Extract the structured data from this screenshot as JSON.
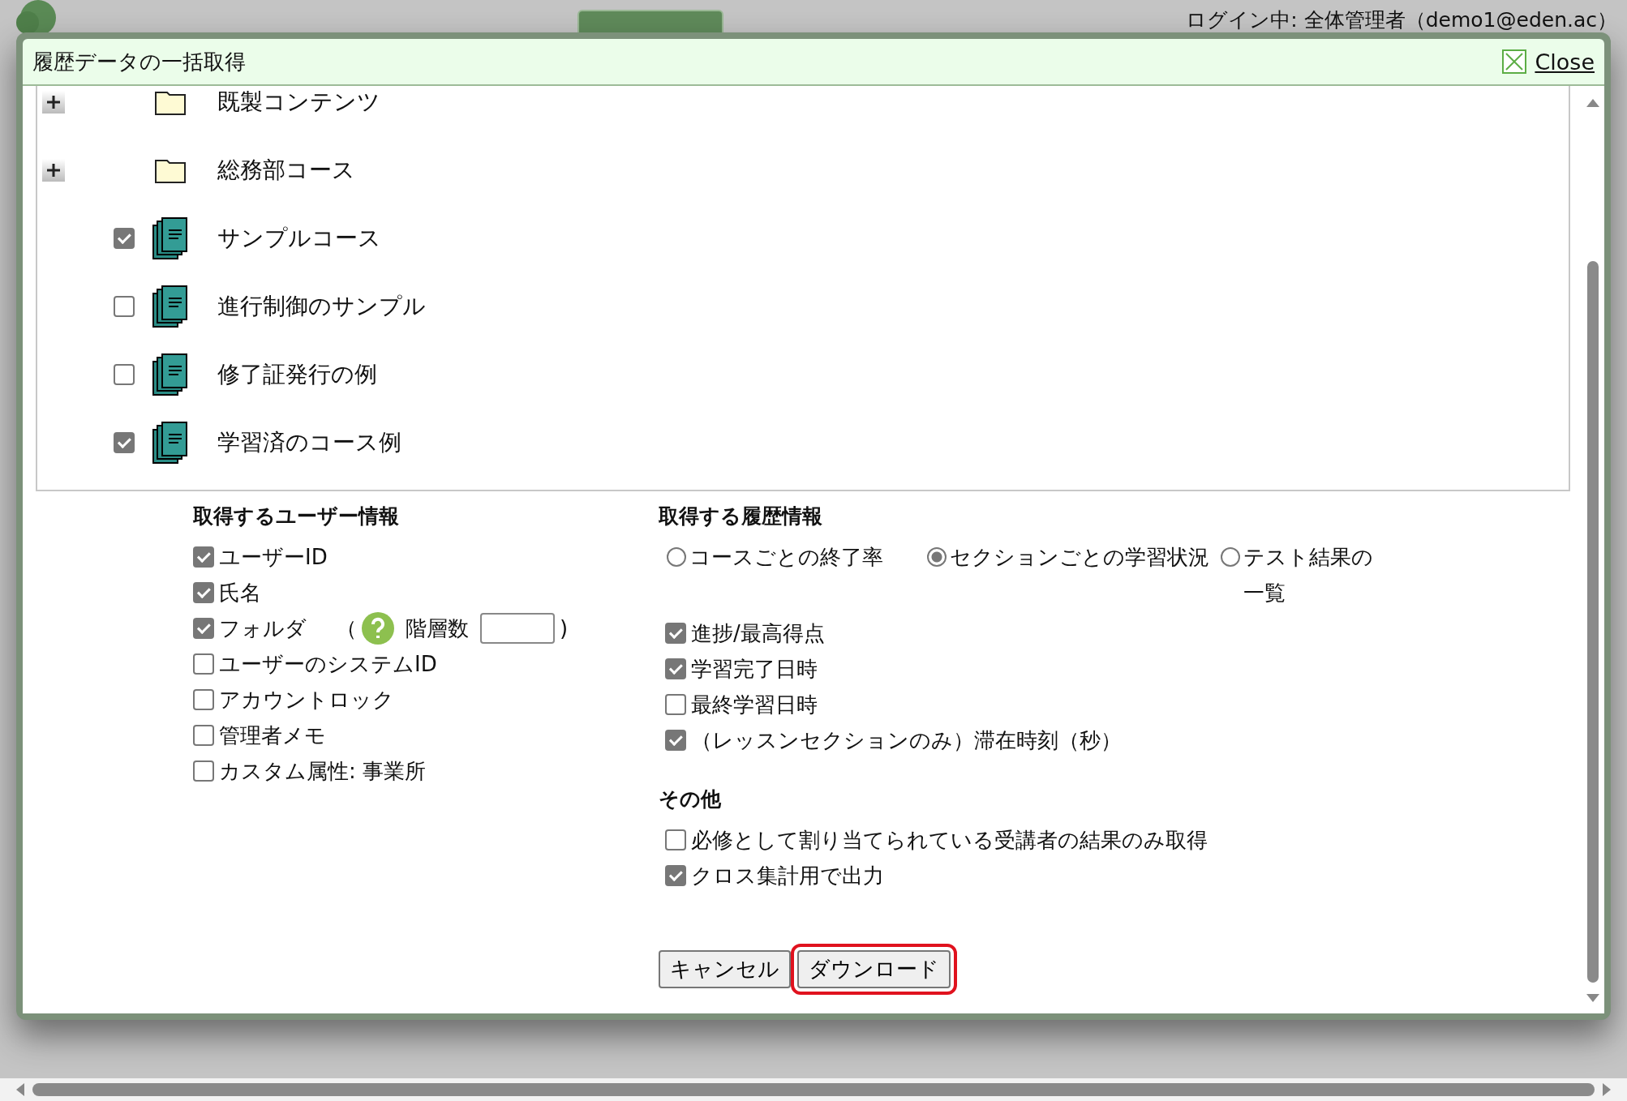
{
  "header": {
    "login": "ログイン中: 全体管理者（demo1@eden.ac）"
  },
  "dialog": {
    "title": "履歴データの一括取得",
    "close": "Close"
  },
  "tree": [
    {
      "kind": "folder",
      "label": "既製コンテンツ",
      "expanded": false
    },
    {
      "kind": "folder",
      "label": "総務部コース",
      "expanded": false
    },
    {
      "kind": "course",
      "label": "サンプルコース",
      "checked": true
    },
    {
      "kind": "course",
      "label": "進行制御のサンプル",
      "checked": false
    },
    {
      "kind": "course",
      "label": "修了証発行の例",
      "checked": false
    },
    {
      "kind": "course",
      "label": "学習済のコース例",
      "checked": true
    }
  ],
  "user_info": {
    "heading": "取得するユーザー情報",
    "items": [
      {
        "kind": "check",
        "label": "ユーザーID",
        "checked": true
      },
      {
        "kind": "check",
        "label": "氏名",
        "checked": true
      },
      {
        "kind": "depth",
        "label": "フォルダ",
        "checked": true,
        "open_paren": "（",
        "field_label": "階層数",
        "close_paren": ")"
      },
      {
        "kind": "check",
        "label": "ユーザーのシステムID",
        "checked": false
      },
      {
        "kind": "check",
        "label": "アカウントロック",
        "checked": false
      },
      {
        "kind": "check",
        "label": "管理者メモ",
        "checked": false
      },
      {
        "kind": "check",
        "label": "カスタム属性: 事業所",
        "checked": false
      }
    ]
  },
  "history_info": {
    "heading": "取得する履歴情報",
    "modes": [
      {
        "label": "コースごとの終了率",
        "selected": false
      },
      {
        "label": "セクションごとの学習状況",
        "selected": true
      },
      {
        "label": "テスト結果の一覧",
        "selected": false
      }
    ],
    "items": [
      {
        "label": "進捗/最高得点",
        "checked": true
      },
      {
        "label": "学習完了日時",
        "checked": true
      },
      {
        "label": "最終学習日時",
        "checked": false
      },
      {
        "label": "（レッスンセクションのみ）滞在時刻（秒）",
        "checked": true
      }
    ]
  },
  "other": {
    "heading": "その他",
    "items": [
      {
        "label": "必修として割り当てられている受講者の結果のみ取得",
        "checked": false
      },
      {
        "label": "クロス集計用で出力",
        "checked": true
      }
    ]
  },
  "buttons": [
    {
      "label": "キャンセル",
      "highlighted": false
    },
    {
      "label": "ダウンロード",
      "highlighted": true
    }
  ]
}
